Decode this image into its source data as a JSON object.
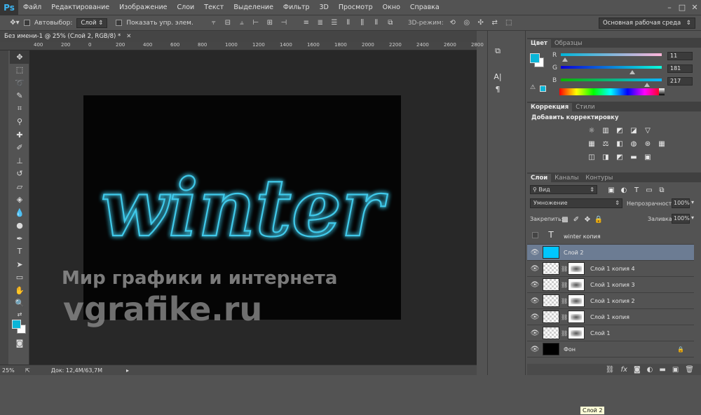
{
  "app": {
    "logo": "Ps",
    "accent": "#31a8ff"
  },
  "menu": [
    "Файл",
    "Редактирование",
    "Изображение",
    "Слои",
    "Текст",
    "Выделение",
    "Фильтр",
    "3D",
    "Просмотр",
    "Окно",
    "Справка"
  ],
  "window_controls": [
    "–",
    "□",
    "✕"
  ],
  "options": {
    "autoselect_label": "Автовыбор:",
    "autoselect_value": "Слой",
    "show_transform_label": "Показать упр. элем.",
    "mode3d_label": "3D-режим:",
    "workspace": "Основная рабочая среда"
  },
  "document": {
    "tab_title": "Без имени-1 @ 25% (Слой 2, RGB/8) *",
    "neon_text": "winter",
    "neon_color": "#3fc9ea",
    "watermark_line1": "Мир графики и интернета",
    "watermark_line2": "vgrafike.ru",
    "ruler_top": [
      "400",
      "200",
      "0",
      "200",
      "400",
      "600",
      "800",
      "1000",
      "1200",
      "1400",
      "1600",
      "1800",
      "2000",
      "2200",
      "2400",
      "2600",
      "2800"
    ]
  },
  "status": {
    "zoom": "25%",
    "doc_info": "Док: 12,4M/63,7M"
  },
  "color_panel": {
    "tabs": [
      "Цвет",
      "Образцы"
    ],
    "fg_color": "#0bb5d7",
    "r_label": "R",
    "g_label": "G",
    "b_label": "B",
    "r": "11",
    "g": "181",
    "b": "217",
    "r_level": 0.043,
    "g_level": 0.71,
    "b_level": 0.851
  },
  "adjustments": {
    "tabs": [
      "Коррекция",
      "Стили"
    ],
    "title": "Добавить корректировку"
  },
  "layers_panel": {
    "tabs": [
      "Слои",
      "Каналы",
      "Контуры"
    ],
    "filter_kind": "Вид",
    "blend_mode": "Умножение",
    "opacity_label": "Непрозрачность:",
    "opacity": "100%",
    "lock_label": "Закрепить:",
    "fill_label": "Заливка:",
    "fill": "100%",
    "tooltip": "Слой 2",
    "layers": [
      {
        "name": "winter копия",
        "kind": "text",
        "visible": false
      },
      {
        "name": "Слой 2",
        "kind": "fill",
        "visible": true,
        "color": "#00c6ff"
      },
      {
        "name": "Слой 1 копия 4",
        "kind": "masked",
        "visible": true
      },
      {
        "name": "Слой 1 копия 3",
        "kind": "masked",
        "visible": true
      },
      {
        "name": "Слой 1 копия 2",
        "kind": "masked",
        "visible": true
      },
      {
        "name": "Слой 1 копия",
        "kind": "masked",
        "visible": true
      },
      {
        "name": "Слой 1",
        "kind": "masked",
        "visible": true
      },
      {
        "name": "Фон",
        "kind": "background",
        "visible": true
      }
    ],
    "footer_icons": [
      "link-icon",
      "fx-icon",
      "mask-icon",
      "adjustment-icon",
      "group-icon",
      "new-layer-icon",
      "trash-icon"
    ]
  }
}
